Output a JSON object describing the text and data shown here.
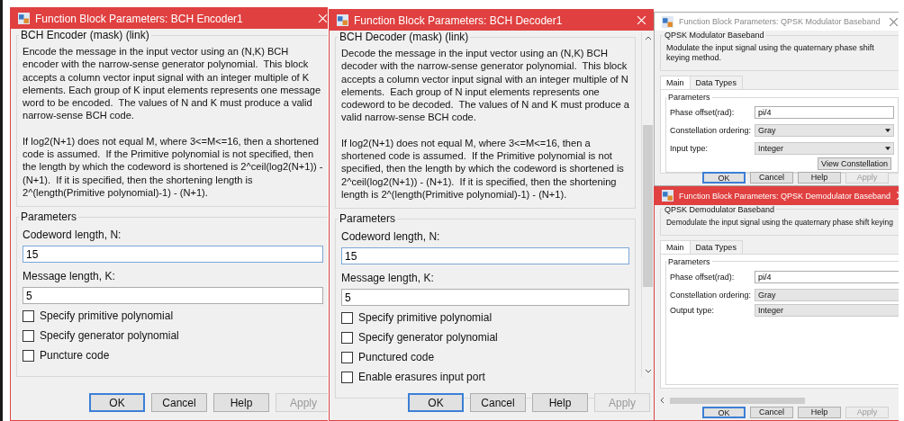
{
  "windows": [
    {
      "kind": "bch",
      "active": true,
      "title": "Function Block Parameters: BCH Encoder1",
      "mask_title": "BCH Encoder (mask) (link)",
      "description": [
        "Encode the message in the input vector using an (N,K) BCH encoder with the narrow-sense generator polynomial.  This block accepts a column vector input signal with an integer multiple of K elements. Each group of K input elements represents one message word to be encoded.  The values of N and K must produce a valid narrow-sense BCH code.",
        "If log2(N+1) does not equal M, where 3<=M<=16, then a shortened code is assumed.  If the Primitive polynomial is not specified, then the length by which the codeword is shortened is 2^ceil(log2(N+1)) - (N+1).  If it is specified, then the shortening length is 2^(length(Primitive polynomial)-1) - (N+1)."
      ],
      "parameters_title": "Parameters",
      "fields": [
        {
          "label": "Codeword length, N:",
          "value": "15",
          "focused": true
        },
        {
          "label": "Message length, K:",
          "value": "5",
          "focused": false
        }
      ],
      "checkboxes": [
        {
          "label": "Specify primitive polynomial",
          "checked": false
        },
        {
          "label": "Specify generator polynomial",
          "checked": false
        },
        {
          "label": "Puncture code",
          "checked": false
        }
      ],
      "buttons": [
        {
          "label": "OK",
          "default": true,
          "disabled": false
        },
        {
          "label": "Cancel",
          "default": false,
          "disabled": false
        },
        {
          "label": "Help",
          "default": false,
          "disabled": false
        },
        {
          "label": "Apply",
          "default": false,
          "disabled": true
        }
      ]
    },
    {
      "kind": "bch",
      "active": true,
      "title": "Function Block Parameters: BCH Decoder1",
      "mask_title": "BCH Decoder (mask) (link)",
      "description": [
        "Decode the message in the input vector using an (N,K) BCH decoder with the narrow-sense generator polynomial.  This block accepts a column vector input signal with an integer multiple of N elements.  Each group of N input elements represents one codeword to be decoded.  The values of N and K must produce a valid narrow-sense BCH code.",
        "If log2(N+1) does not equal M, where 3<=M<=16, then a shortened code is assumed.  If the Primitive polynomial is not specified, then the length by which the codeword is shortened is 2^ceil(log2(N+1)) - (N+1).  If it is specified, then the shortening length is 2^(length(Primitive polynomial)-1) - (N+1)."
      ],
      "parameters_title": "Parameters",
      "fields": [
        {
          "label": "Codeword length, N:",
          "value": "15",
          "focused": true
        },
        {
          "label": "Message length, K:",
          "value": "5",
          "focused": false
        }
      ],
      "checkboxes": [
        {
          "label": "Specify primitive polynomial",
          "checked": false
        },
        {
          "label": "Specify generator polynomial",
          "checked": false
        },
        {
          "label": "Punctured code",
          "checked": false
        },
        {
          "label": "Enable erasures input port",
          "checked": false
        }
      ],
      "buttons": [
        {
          "label": "OK",
          "default": true,
          "disabled": false
        },
        {
          "label": "Cancel",
          "default": false,
          "disabled": false
        },
        {
          "label": "Help",
          "default": false,
          "disabled": false
        },
        {
          "label": "Apply",
          "default": false,
          "disabled": true
        }
      ]
    },
    {
      "kind": "qpsk",
      "active": false,
      "title": "Function Block Parameters: QPSK Modulator Baseband",
      "mask_title": "QPSK Modulator Baseband",
      "description": [
        "Modulate the input signal using the quaternary phase shift keying method."
      ],
      "tabs": [
        {
          "label": "Main",
          "selected": true
        },
        {
          "label": "Data Types",
          "selected": false
        }
      ],
      "parameters_title": "Parameters",
      "params": [
        {
          "label": "Phase offset(rad):",
          "kind": "text",
          "value": "pi/4"
        },
        {
          "label": "Constellation ordering:",
          "kind": "dropdown",
          "value": "Gray"
        },
        {
          "label": "Input type:",
          "kind": "dropdown",
          "value": "Integer"
        }
      ],
      "action_button": "View Constellation",
      "buttons": [
        {
          "label": "OK",
          "default": true,
          "disabled": false
        },
        {
          "label": "Cancel",
          "default": false,
          "disabled": false
        },
        {
          "label": "Help",
          "default": false,
          "disabled": false
        },
        {
          "label": "Apply",
          "default": false,
          "disabled": true
        }
      ]
    },
    {
      "kind": "qpsk",
      "active": true,
      "title": "Function Block Parameters: QPSK Demodulator Baseband",
      "mask_title": "QPSK Demodulator Baseband",
      "description": [
        "Demodulate the input signal using the quaternary phase shift keying"
      ],
      "tabs": [
        {
          "label": "Main",
          "selected": true
        },
        {
          "label": "Data Types",
          "selected": false
        }
      ],
      "parameters_title": "Parameters",
      "params": [
        {
          "label": "Phase offset(rad):",
          "kind": "text",
          "value": "pi/4"
        },
        {
          "label": "Constellation ordering:",
          "kind": "dropdown",
          "value": "Gray"
        },
        {
          "label": "Output type:",
          "kind": "dropdown",
          "value": "Integer"
        }
      ],
      "buttons": [
        {
          "label": "OK",
          "default": true,
          "disabled": false
        },
        {
          "label": "Cancel",
          "default": false,
          "disabled": false
        },
        {
          "label": "Help",
          "default": false,
          "disabled": false
        },
        {
          "label": "Apply",
          "default": false,
          "disabled": true
        }
      ]
    }
  ]
}
